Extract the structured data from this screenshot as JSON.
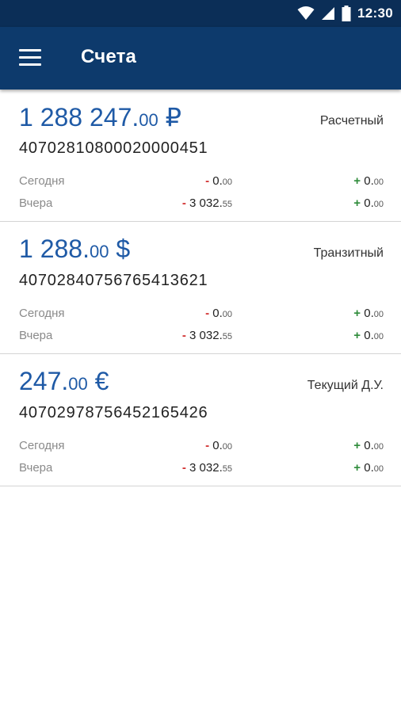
{
  "status_bar": {
    "time": "12:30",
    "icons": [
      "wifi-icon",
      "signal-icon",
      "battery-icon"
    ]
  },
  "app_bar": {
    "title": "Счета",
    "menu_icon": "menu-icon"
  },
  "colors": {
    "status_bar": "#0b2e57",
    "app_bar": "#0d3a6c",
    "balance": "#1f5aa6",
    "negative": "#d12f2f",
    "positive": "#2e8b3a"
  },
  "accounts": [
    {
      "balance_main": "1 288 247.",
      "balance_cents": "00",
      "currency": "₽",
      "type": "Расчетный",
      "number": "40702810800020000451",
      "today": {
        "label": "Сегодня",
        "out_sign": "-",
        "out_main": "0.",
        "out_cents": "00",
        "in_sign": "+",
        "in_main": "0.",
        "in_cents": "00"
      },
      "yesterday": {
        "label": "Вчера",
        "out_sign": "-",
        "out_main": "3 032.",
        "out_cents": "55",
        "in_sign": "+",
        "in_main": "0.",
        "in_cents": "00"
      }
    },
    {
      "balance_main": "1 288.",
      "balance_cents": "00",
      "currency": "$",
      "type": "Транзитный",
      "number": "40702840756765413621",
      "today": {
        "label": "Сегодня",
        "out_sign": "-",
        "out_main": "0.",
        "out_cents": "00",
        "in_sign": "+",
        "in_main": "0.",
        "in_cents": "00"
      },
      "yesterday": {
        "label": "Вчера",
        "out_sign": "-",
        "out_main": "3 032.",
        "out_cents": "55",
        "in_sign": "+",
        "in_main": "0.",
        "in_cents": "00"
      }
    },
    {
      "balance_main": "247.",
      "balance_cents": "00",
      "currency": "€",
      "type": "Текущий Д.У.",
      "number": "40702978756452165426",
      "today": {
        "label": "Сегодня",
        "out_sign": "-",
        "out_main": "0.",
        "out_cents": "00",
        "in_sign": "+",
        "in_main": "0.",
        "in_cents": "00"
      },
      "yesterday": {
        "label": "Вчера",
        "out_sign": "-",
        "out_main": "3 032.",
        "out_cents": "55",
        "in_sign": "+",
        "in_main": "0.",
        "in_cents": "00"
      }
    }
  ]
}
